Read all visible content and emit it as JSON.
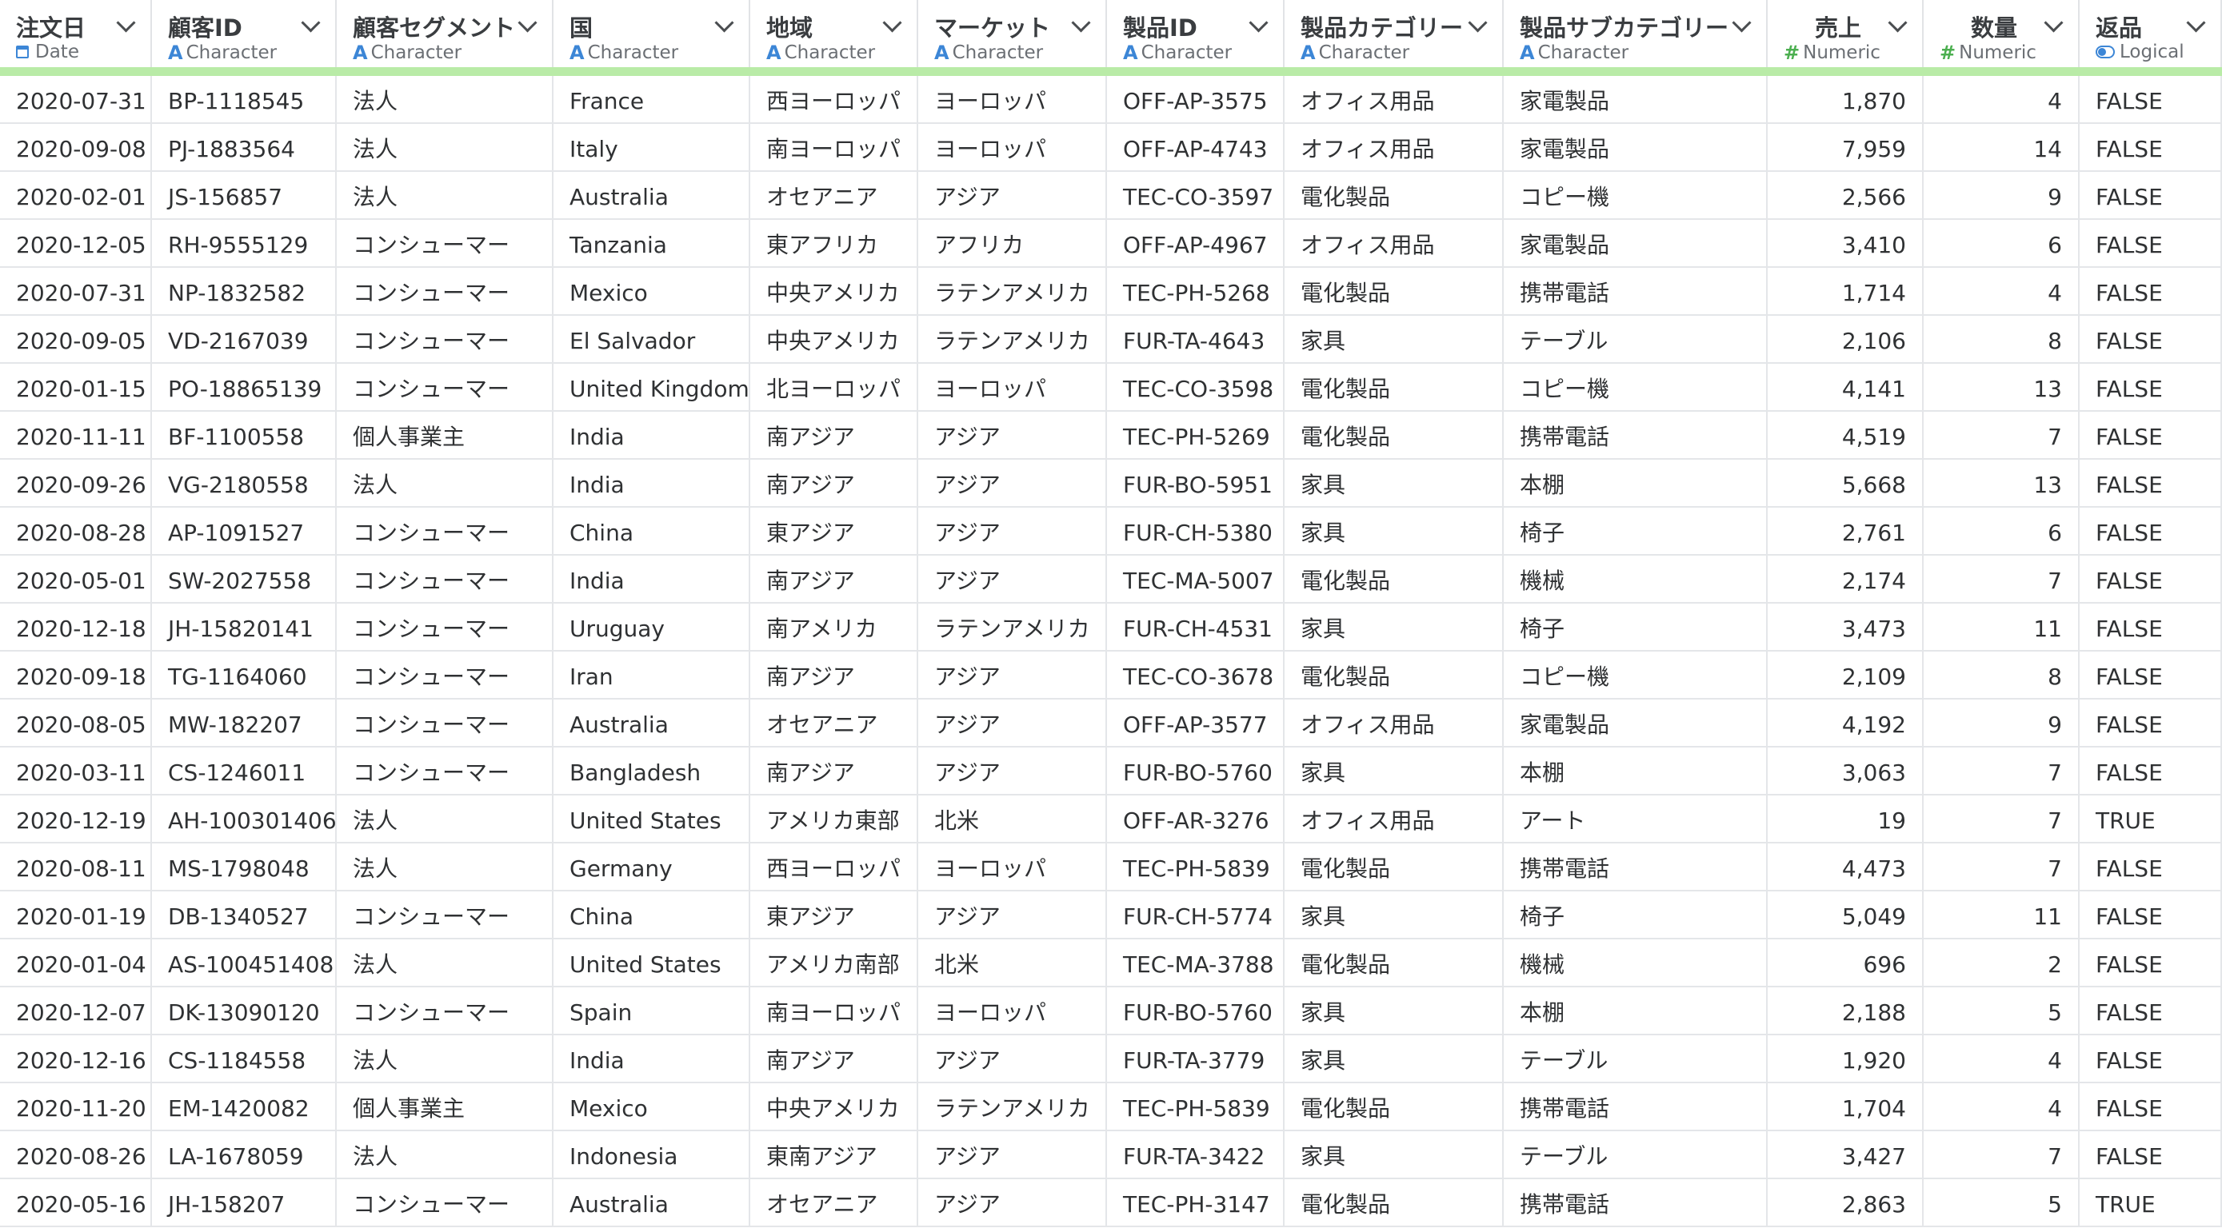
{
  "columns": [
    {
      "name": "注文日",
      "type": "Date",
      "icon": "calendar-icon"
    },
    {
      "name": "顧客ID",
      "type": "Character",
      "icon": "character-type-icon"
    },
    {
      "name": "顧客セグメント",
      "type": "Character",
      "icon": "character-type-icon"
    },
    {
      "name": "国",
      "type": "Character",
      "icon": "character-type-icon"
    },
    {
      "name": "地域",
      "type": "Character",
      "icon": "character-type-icon"
    },
    {
      "name": "マーケット",
      "type": "Character",
      "icon": "character-type-icon"
    },
    {
      "name": "製品ID",
      "type": "Character",
      "icon": "character-type-icon"
    },
    {
      "name": "製品カテゴリー",
      "type": "Character",
      "icon": "character-type-icon"
    },
    {
      "name": "製品サブカテゴリー",
      "type": "Character",
      "icon": "character-type-icon"
    },
    {
      "name": "売上",
      "type": "Numeric",
      "icon": "numeric-type-icon"
    },
    {
      "name": "数量",
      "type": "Numeric",
      "icon": "numeric-type-icon"
    },
    {
      "name": "返品",
      "type": "Logical",
      "icon": "logical-type-icon"
    }
  ],
  "rows": [
    [
      "2020-07-31",
      "BP-1118545",
      "法人",
      "France",
      "西ヨーロッパ",
      "ヨーロッパ",
      "OFF-AP-3575",
      "オフィス用品",
      "家電製品",
      "1,870",
      "4",
      "FALSE"
    ],
    [
      "2020-09-08",
      "PJ-1883564",
      "法人",
      "Italy",
      "南ヨーロッパ",
      "ヨーロッパ",
      "OFF-AP-4743",
      "オフィス用品",
      "家電製品",
      "7,959",
      "14",
      "FALSE"
    ],
    [
      "2020-02-01",
      "JS-156857",
      "法人",
      "Australia",
      "オセアニア",
      "アジア",
      "TEC-CO-3597",
      "電化製品",
      "コピー機",
      "2,566",
      "9",
      "FALSE"
    ],
    [
      "2020-12-05",
      "RH-9555129",
      "コンシューマー",
      "Tanzania",
      "東アフリカ",
      "アフリカ",
      "OFF-AP-4967",
      "オフィス用品",
      "家電製品",
      "3,410",
      "6",
      "FALSE"
    ],
    [
      "2020-07-31",
      "NP-1832582",
      "コンシューマー",
      "Mexico",
      "中央アメリカ",
      "ラテンアメリカ",
      "TEC-PH-5268",
      "電化製品",
      "携帯電話",
      "1,714",
      "4",
      "FALSE"
    ],
    [
      "2020-09-05",
      "VD-2167039",
      "コンシューマー",
      "El Salvador",
      "中央アメリカ",
      "ラテンアメリカ",
      "FUR-TA-4643",
      "家具",
      "テーブル",
      "2,106",
      "8",
      "FALSE"
    ],
    [
      "2020-01-15",
      "PO-18865139",
      "コンシューマー",
      "United Kingdom",
      "北ヨーロッパ",
      "ヨーロッパ",
      "TEC-CO-3598",
      "電化製品",
      "コピー機",
      "4,141",
      "13",
      "FALSE"
    ],
    [
      "2020-11-11",
      "BF-1100558",
      "個人事業主",
      "India",
      "南アジア",
      "アジア",
      "TEC-PH-5269",
      "電化製品",
      "携帯電話",
      "4,519",
      "7",
      "FALSE"
    ],
    [
      "2020-09-26",
      "VG-2180558",
      "法人",
      "India",
      "南アジア",
      "アジア",
      "FUR-BO-5951",
      "家具",
      "本棚",
      "5,668",
      "13",
      "FALSE"
    ],
    [
      "2020-08-28",
      "AP-1091527",
      "コンシューマー",
      "China",
      "東アジア",
      "アジア",
      "FUR-CH-5380",
      "家具",
      "椅子",
      "2,761",
      "6",
      "FALSE"
    ],
    [
      "2020-05-01",
      "SW-2027558",
      "コンシューマー",
      "India",
      "南アジア",
      "アジア",
      "TEC-MA-5007",
      "電化製品",
      "機械",
      "2,174",
      "7",
      "FALSE"
    ],
    [
      "2020-12-18",
      "JH-15820141",
      "コンシューマー",
      "Uruguay",
      "南アメリカ",
      "ラテンアメリカ",
      "FUR-CH-4531",
      "家具",
      "椅子",
      "3,473",
      "11",
      "FALSE"
    ],
    [
      "2020-09-18",
      "TG-1164060",
      "コンシューマー",
      "Iran",
      "南アジア",
      "アジア",
      "TEC-CO-3678",
      "電化製品",
      "コピー機",
      "2,109",
      "8",
      "FALSE"
    ],
    [
      "2020-08-05",
      "MW-182207",
      "コンシューマー",
      "Australia",
      "オセアニア",
      "アジア",
      "OFF-AP-3577",
      "オフィス用品",
      "家電製品",
      "4,192",
      "9",
      "FALSE"
    ],
    [
      "2020-03-11",
      "CS-1246011",
      "コンシューマー",
      "Bangladesh",
      "南アジア",
      "アジア",
      "FUR-BO-5760",
      "家具",
      "本棚",
      "3,063",
      "7",
      "FALSE"
    ],
    [
      "2020-12-19",
      "AH-100301406",
      "法人",
      "United States",
      "アメリカ東部",
      "北米",
      "OFF-AR-3276",
      "オフィス用品",
      "アート",
      "19",
      "7",
      "TRUE"
    ],
    [
      "2020-08-11",
      "MS-1798048",
      "法人",
      "Germany",
      "西ヨーロッパ",
      "ヨーロッパ",
      "TEC-PH-5839",
      "電化製品",
      "携帯電話",
      "4,473",
      "7",
      "FALSE"
    ],
    [
      "2020-01-19",
      "DB-1340527",
      "コンシューマー",
      "China",
      "東アジア",
      "アジア",
      "FUR-CH-5774",
      "家具",
      "椅子",
      "5,049",
      "11",
      "FALSE"
    ],
    [
      "2020-01-04",
      "AS-100451408",
      "法人",
      "United States",
      "アメリカ南部",
      "北米",
      "TEC-MA-3788",
      "電化製品",
      "機械",
      "696",
      "2",
      "FALSE"
    ],
    [
      "2020-12-07",
      "DK-13090120",
      "コンシューマー",
      "Spain",
      "南ヨーロッパ",
      "ヨーロッパ",
      "FUR-BO-5760",
      "家具",
      "本棚",
      "2,188",
      "5",
      "FALSE"
    ],
    [
      "2020-12-16",
      "CS-1184558",
      "法人",
      "India",
      "南アジア",
      "アジア",
      "FUR-TA-3779",
      "家具",
      "テーブル",
      "1,920",
      "4",
      "FALSE"
    ],
    [
      "2020-11-20",
      "EM-1420082",
      "個人事業主",
      "Mexico",
      "中央アメリカ",
      "ラテンアメリカ",
      "TEC-PH-5839",
      "電化製品",
      "携帯電話",
      "1,704",
      "4",
      "FALSE"
    ],
    [
      "2020-08-26",
      "LA-1678059",
      "法人",
      "Indonesia",
      "東南アジア",
      "アジア",
      "FUR-TA-3422",
      "家具",
      "テーブル",
      "3,427",
      "7",
      "FALSE"
    ],
    [
      "2020-05-16",
      "JH-158207",
      "コンシューマー",
      "Australia",
      "オセアニア",
      "アジア",
      "TEC-PH-3147",
      "電化製品",
      "携帯電話",
      "2,863",
      "5",
      "TRUE"
    ]
  ],
  "colors": {
    "type_icon_blue": "#3c86d6",
    "type_icon_green": "#4caf50",
    "header_quality_bar": "#b9eba7",
    "grid_line": "#e4e6e9"
  }
}
